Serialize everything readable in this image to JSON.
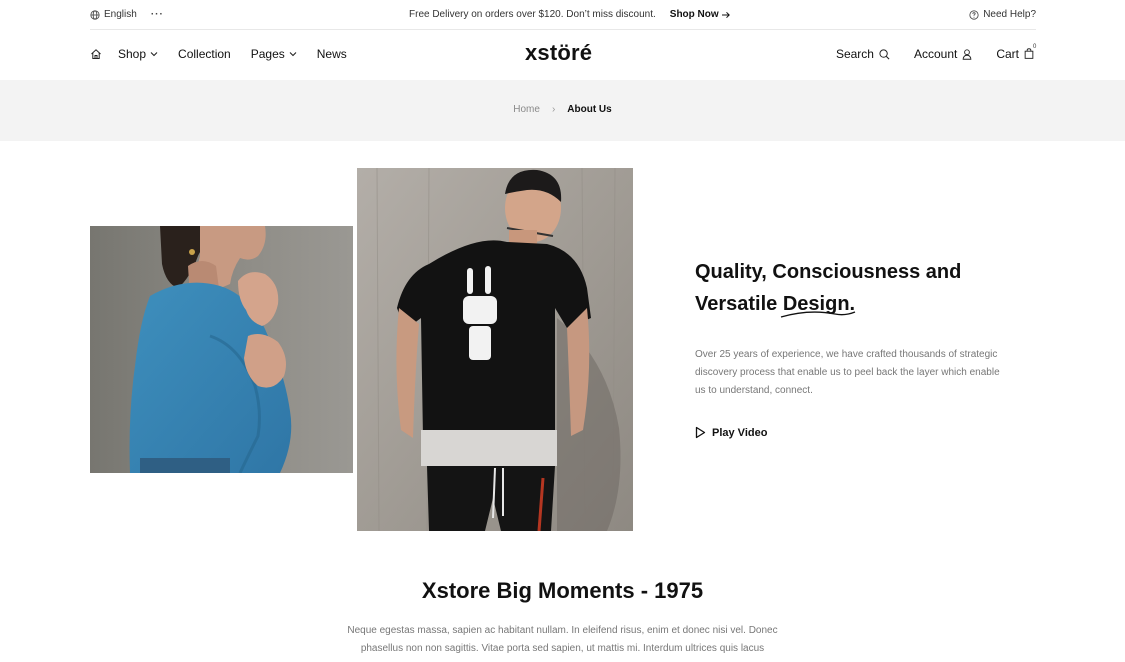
{
  "topbar": {
    "language": "English",
    "more": "···",
    "promo_text": "Free Delivery on orders over $120. Don’t miss discount.",
    "promo_link": "Shop Now",
    "help": "Need Help?"
  },
  "header": {
    "logo": "xstöré",
    "nav": {
      "shop": "Shop",
      "collection": "Collection",
      "pages": "Pages",
      "news": "News"
    },
    "actions": {
      "search": "Search",
      "account": "Account",
      "cart": "Cart",
      "cart_count": "0"
    }
  },
  "breadcrumb": {
    "home": "Home",
    "separator": "›",
    "current": "About Us"
  },
  "about": {
    "headline_line1": "Quality, Consciousness and",
    "headline_line2_prefix": "Versatile",
    "headline_line2_word": "Design",
    "headline_line2_suffix": ".",
    "description": "Over 25 years of experience, we have crafted thousands of strategic discovery process that enable us to peel back the layer which enable us to understand, connect.",
    "play_label": "Play Video"
  },
  "moments": {
    "title": "Xstore Big Moments - 1975",
    "text": "Neque egestas massa, sapien ac habitant nullam. In eleifend risus, enim et donec nisi vel. Donec phasellus non non sagittis. Vitae porta sed sapien, ut mattis mi. Interdum ultrices quis lacus"
  },
  "colors": {
    "text": "#111111",
    "muted": "#777777",
    "band": "#f3f3f3"
  }
}
